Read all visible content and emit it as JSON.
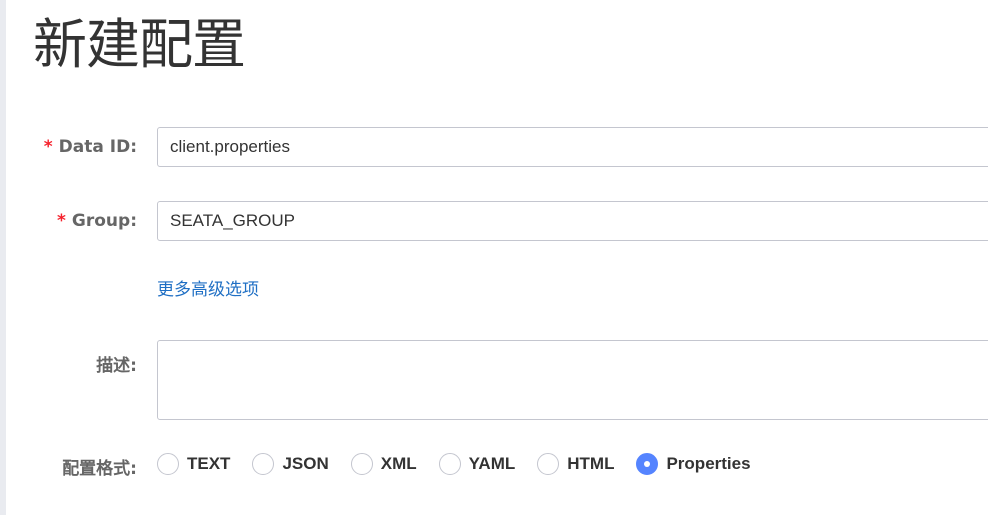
{
  "title": "新建配置",
  "form": {
    "data_id": {
      "required_mark": "*",
      "label": "Data ID:",
      "value": "client.properties"
    },
    "group": {
      "required_mark": "*",
      "label": "Group:",
      "value": "SEATA_GROUP"
    },
    "advanced_link": "更多高级选项",
    "description": {
      "label": "描述:",
      "value": ""
    },
    "format": {
      "label": "配置格式:",
      "options": [
        "TEXT",
        "JSON",
        "XML",
        "YAML",
        "HTML",
        "Properties"
      ],
      "selected": "Properties"
    }
  },
  "colors": {
    "accent": "#5584ff",
    "link": "#1f6fc4",
    "required": "#f5222d"
  }
}
